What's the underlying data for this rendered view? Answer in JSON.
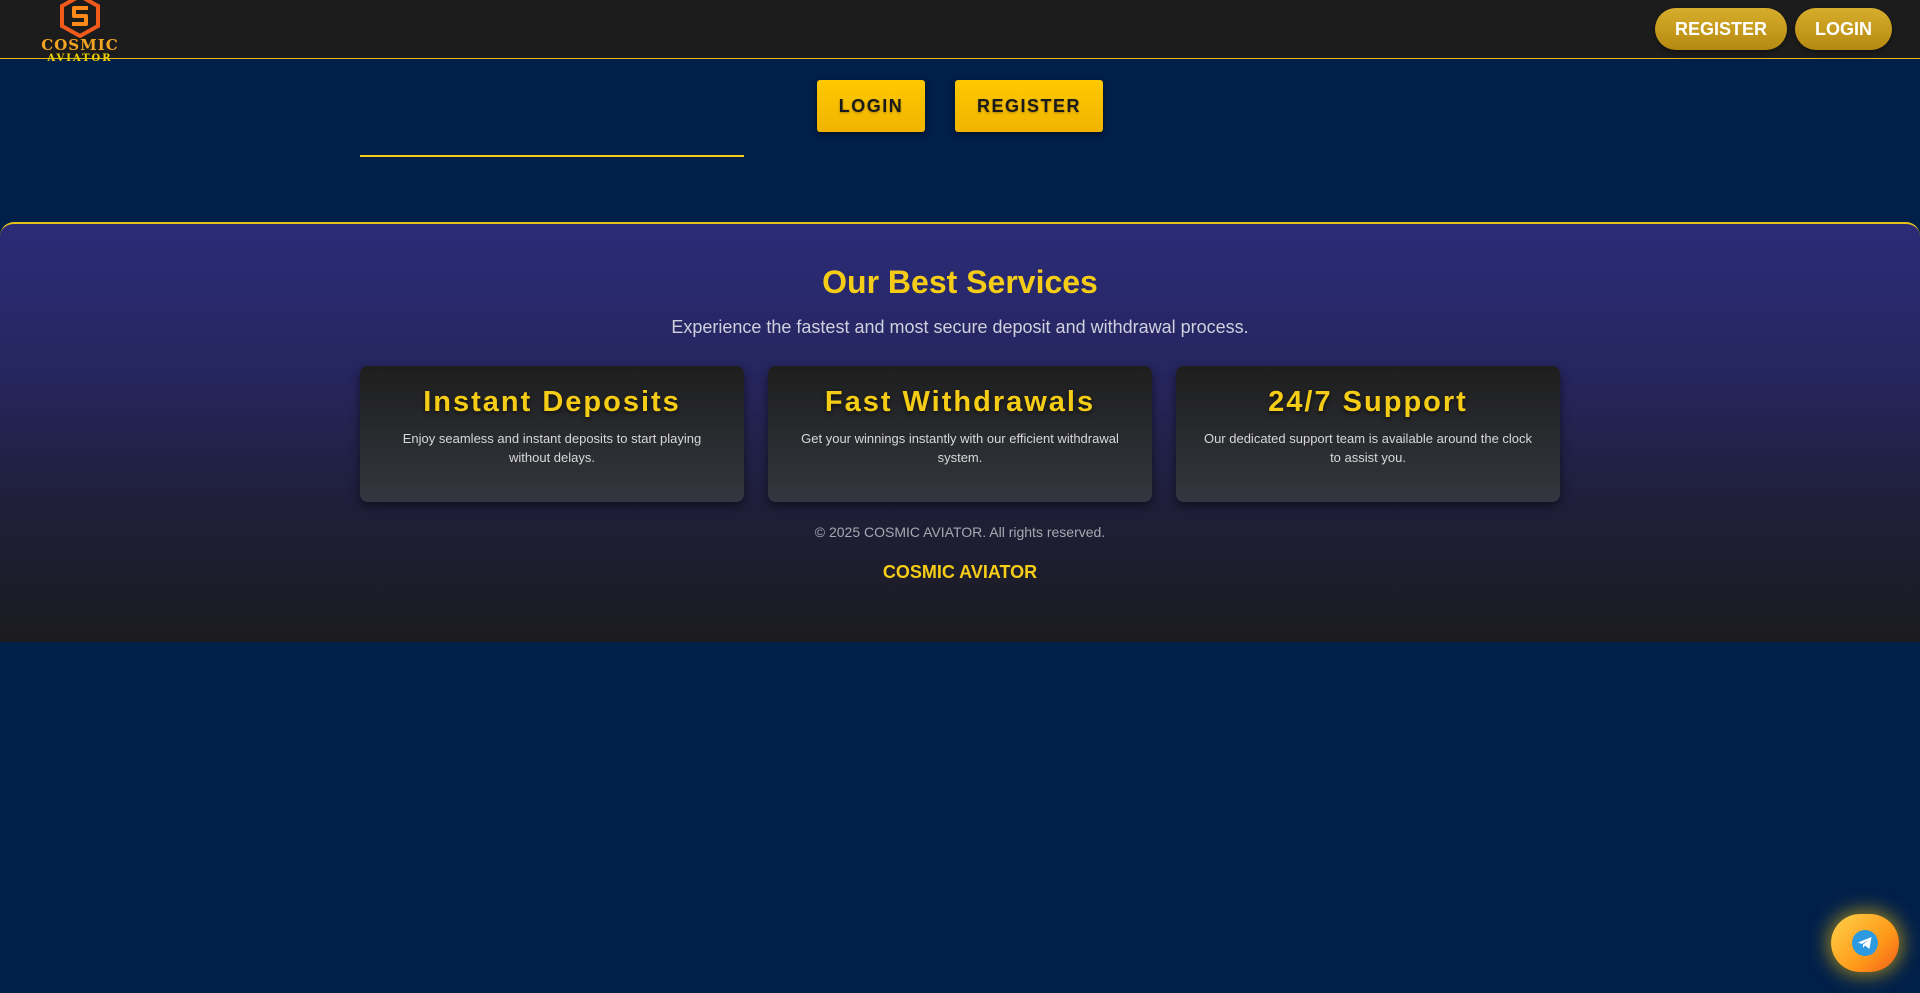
{
  "header": {
    "logo_line1": "COSMIC",
    "logo_line2": "AVIATOR",
    "register_label": "REGISTER",
    "login_label": "LOGIN"
  },
  "cta": {
    "login_label": "LOGIN",
    "register_label": "REGISTER"
  },
  "services": {
    "title": "Our Best Services",
    "subtitle": "Experience the fastest and most secure deposit and withdrawal process.",
    "cards": [
      {
        "title": "Instant Deposits",
        "description": "Enjoy seamless and instant deposits to start playing without delays."
      },
      {
        "title": "Fast Withdrawals",
        "description": "Get your winnings instantly with our efficient withdrawal system."
      },
      {
        "title": "24/7 Support",
        "description": "Our dedicated support team is available around the clock to assist you."
      }
    ]
  },
  "footer": {
    "copyright": "© 2025 COSMIC AVIATOR. All rights reserved.",
    "brand": "COSMIC AVIATOR"
  },
  "floating": {
    "icon": "telegram-icon"
  },
  "colors": {
    "page_background": "#001f49",
    "accent_gold": "#f5cc16",
    "header_background": "#1c1c1c"
  }
}
